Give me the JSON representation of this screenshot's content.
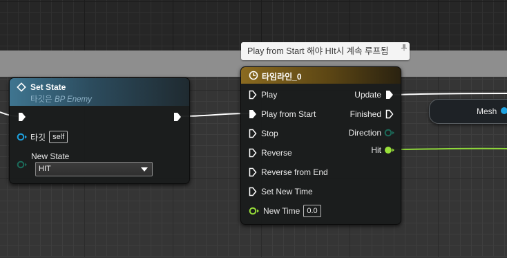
{
  "comment": {
    "text": "Play from Start 해야 HIt시 계속 루프됨"
  },
  "set_state": {
    "title": "Set State",
    "subtitle_prefix": "타깃은 ",
    "subtitle_class": "BP Enemy",
    "target_label": "타깃",
    "target_value": "self",
    "new_state_label": "New State",
    "new_state_value": "HIT"
  },
  "timeline": {
    "title": "타임라인_0",
    "inputs": [
      "Play",
      "Play from Start",
      "Stop",
      "Reverse",
      "Reverse from End",
      "Set New Time"
    ],
    "new_time_label": "New Time",
    "new_time_value": "0.0",
    "outputs": [
      "Update",
      "Finished",
      "Direction",
      "Hit"
    ]
  },
  "mesh": {
    "label": "Mesh"
  },
  "colors": {
    "set_state_header": "#356078",
    "timeline_header": "#7c5f1d",
    "object_pin": "#1ea2e0",
    "float_pin": "#99e03a",
    "enum_pin": "#1b6b5a",
    "exec_wire": "#ffffff",
    "float_wire": "#8fd83a"
  }
}
